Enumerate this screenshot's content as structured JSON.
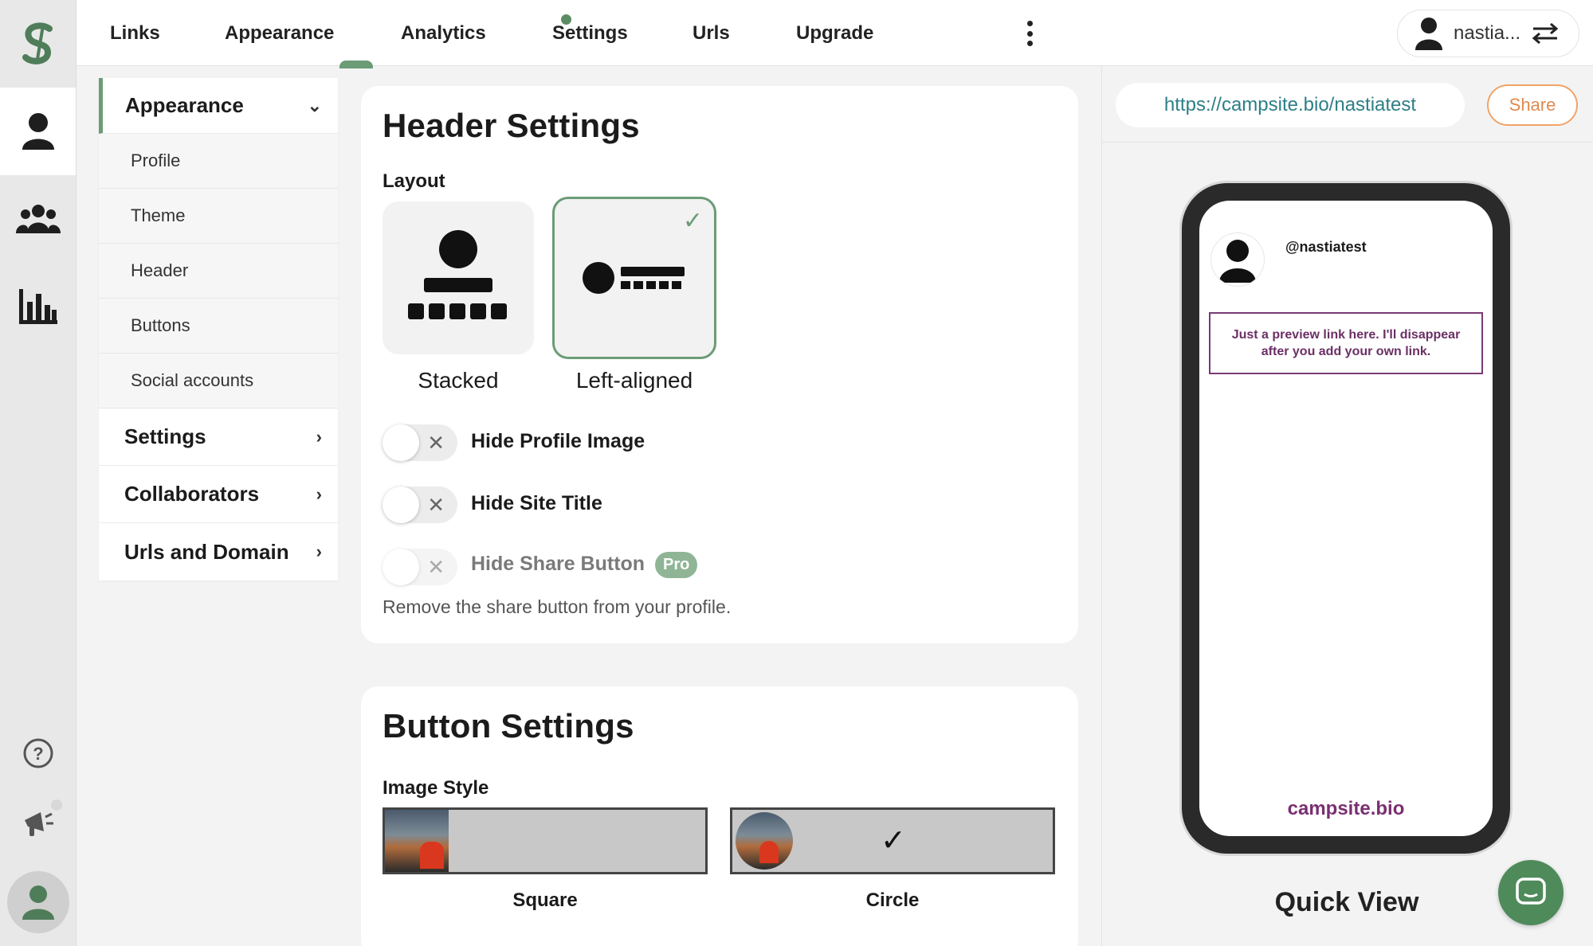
{
  "topnav": {
    "items": [
      "Links",
      "Appearance",
      "Analytics",
      "Settings",
      "Urls",
      "Upgrade"
    ],
    "active": "Appearance",
    "user_name": "nastia..."
  },
  "sidebar": {
    "appearance_label": "Appearance",
    "appearance_items": [
      "Profile",
      "Theme",
      "Header",
      "Buttons",
      "Social accounts"
    ],
    "sections": [
      "Settings",
      "Collaborators",
      "Urls and Domain"
    ]
  },
  "header_settings": {
    "title": "Header Settings",
    "layout_label": "Layout",
    "layouts": [
      "Stacked",
      "Left-aligned"
    ],
    "selected_layout": "Left-aligned",
    "toggles": [
      {
        "label": "Hide Profile Image",
        "on": false
      },
      {
        "label": "Hide Site Title",
        "on": false
      },
      {
        "label": "Hide Share Button",
        "on": false,
        "badge": "Pro"
      }
    ],
    "share_hint": "Remove the share button from your profile."
  },
  "button_settings": {
    "title": "Button Settings",
    "image_style_label": "Image Style",
    "styles": [
      "Square",
      "Circle"
    ],
    "selected_style": "Circle"
  },
  "preview": {
    "url": "https://campsite.bio/nastiatest",
    "share_label": "Share",
    "handle": "@nastiatest",
    "link_text": "Just a preview link here. I'll disappear after you add your own link.",
    "brand": "campsite.bio",
    "quick_view": "Quick View"
  },
  "colors": {
    "accent": "#6b9c76",
    "link_purple": "#7a3a73",
    "url_teal": "#2d7f86",
    "share_orange": "#e08a4f"
  },
  "icons": {
    "rail": [
      "campsite-logo-icon",
      "profile-icon",
      "team-icon",
      "bar-chart-icon",
      "help-icon",
      "megaphone-icon",
      "account-avatar-icon"
    ],
    "swap": "swap-arrows-icon",
    "menu": "kebab-menu-icon",
    "chat": "chat-bubble-icon"
  }
}
